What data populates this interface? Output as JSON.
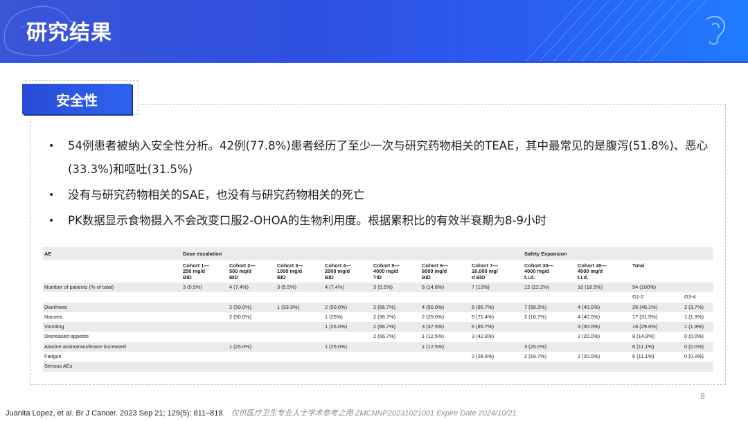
{
  "header": {
    "title": "研究结果"
  },
  "section": {
    "label": "安全性"
  },
  "bullets": [
    "54例患者被纳入安全性分析。42例(77.8%)患者经历了至少一次与研究药物相关的TEAE，其中最常见的是腹泻(51.8%)、恶心(33.3%)和呕吐(31.5%)",
    "没有与研究药物相关的SAE，也没有与研究药物相关的死亡",
    "PK数据显示食物摄入不会改变口服2-OHOA的生物利用度。根据累积比的有效半衰期为8-9小时"
  ],
  "bullet_symbol": "•",
  "table": {
    "ae_header": "AE",
    "dose_escalation": "Dose escalation",
    "safety_expansion": "Safety Expansion",
    "cohorts": [
      "Cohort 1—\n250 mg/d\nBID",
      "Cohort 2—\n500 mg/d\nBID",
      "Cohort 3—\n1000 mg/d\nBID",
      "Cohort 4—\n2000 mg/d\nBID",
      "Cohort 5—\n4000 mg/d\nTID",
      "Cohort 6—\n8000 mg/d\nBID",
      "Cohort 7—\n16,000 mg/\nd BID",
      "Cohort 30—\n4000 mg/d\nt.i.d.",
      "Cohort 40—\n4000 mg/d\nt.i.d.",
      "Total",
      ""
    ],
    "patients_row": {
      "label": "Number of patients (% of total)",
      "cells": [
        "3 (5.5%)",
        "4 (7.4%)",
        "3 (5.5%)",
        "4 (7.4%)",
        "3 (5.5%)",
        "8 (14.8%)",
        "7 (13%)",
        "12 (22.2%)",
        "10 (18.5%)",
        "54 (100%)",
        ""
      ]
    },
    "grade_row": {
      "g12": "G1-2",
      "g34": "G3-4"
    },
    "rows": [
      {
        "label": "Diarrhoea",
        "cells": [
          "",
          "2 (50.0%)",
          "1 (33.3%)",
          "2 (50.0%)",
          "2 (66.7%)",
          "4 (50.0%)",
          "6 (85.7%)",
          "7 (58.3%)",
          "4 (40.0%)",
          "26 (48.1%)",
          "2 (3.7%)"
        ]
      },
      {
        "label": "Nausea",
        "cells": [
          "",
          "2 (50.0%)",
          "",
          "1 (25%)",
          "2 (66.7%)",
          "2 (25.0%)",
          "5 (71.4%)",
          "2 (16.7%)",
          "4 (40.0%)",
          "17 (31.5%)",
          "1 (1.9%)"
        ]
      },
      {
        "label": "Vomiting",
        "cells": [
          "",
          "",
          "",
          "1 (25.0%)",
          "2 (66.7%)",
          "3 (37.5%)",
          "6 (85.7%)",
          "",
          "3 (30.0%)",
          "16 (29.6%)",
          "1 (1.9%)"
        ]
      },
      {
        "label": "Decreased appetite",
        "cells": [
          "",
          "",
          "",
          "",
          "2 (66.7%)",
          "1 (12.5%)",
          "3 (42.9%)",
          "",
          "2 (20.0%)",
          "8 (14.8%)",
          "0 (0.0%)"
        ]
      },
      {
        "label": "Alanine aminotransferase increased",
        "cells": [
          "",
          "1 (25.0%)",
          "",
          "1 (25.0%)",
          "",
          "1 (12.5%)",
          "",
          "3 (25.0%)",
          "",
          "6 (11.1%)",
          "0 (0.0%)"
        ]
      },
      {
        "label": "Fatigue",
        "cells": [
          "",
          "",
          "",
          "",
          "",
          "",
          "2 (28.6%)",
          "2 (16.7%)",
          "2 (20.0%)",
          "6 (11.1%)",
          "0 (0.0%)"
        ]
      },
      {
        "label": "Serious AEs",
        "cells": [
          "",
          "",
          "",
          "",
          "",
          "",
          "",
          "",
          "",
          "",
          ""
        ]
      }
    ]
  },
  "footer": {
    "citation": "Juanita Lopez, et al. Br J Cancer. 2023 Sep 21; 129(5): 811–818.",
    "watermark": "仅供医疗卫生专业人士学术参考之用 ZMCNNP20231021001 Expire Date 2024/10/21"
  },
  "page_number": "8",
  "colors": {
    "primary_blue": "#2f4fe0",
    "accent_blue": "#1f7cff",
    "table_band": "#ebebeb"
  },
  "icons": {
    "header_decoration": "brain-network-icon",
    "ear": "ear-icon"
  }
}
